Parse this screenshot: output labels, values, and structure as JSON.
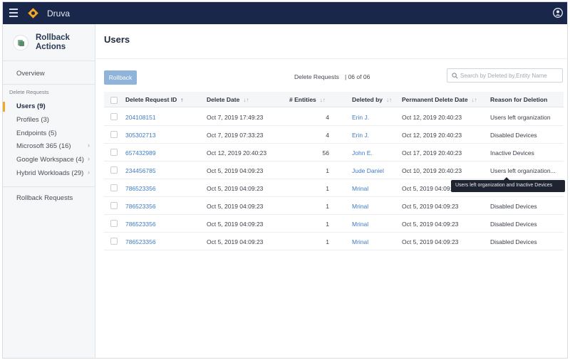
{
  "app": {
    "brand": "Druva"
  },
  "colors": {
    "topbar": "#19284a",
    "accent": "#f5a623",
    "link": "#3f7bc4",
    "button": "#8fb3d9"
  },
  "sidebar": {
    "title": "Rollback Actions",
    "overview": "Overview",
    "section_label": "Delete Requests",
    "items": [
      {
        "label": "Users (9)",
        "active": true
      },
      {
        "label": "Profiles (3)"
      },
      {
        "label": "Endpoints (5)"
      },
      {
        "label": "Microsoft 365 (16)",
        "has_children": true
      },
      {
        "label": "Google Workspace (4)",
        "has_children": true
      },
      {
        "label": "Hybrid Workloads (29)",
        "has_children": true
      }
    ],
    "rollback_requests": "Rollback Requests"
  },
  "main": {
    "title": "Users",
    "rollback_button": "Rollback",
    "count_label": "Delete Requests",
    "count_value": "| 06 of 06",
    "search_placeholder": "Search by Deleted by,Entity Name"
  },
  "table": {
    "columns": [
      "Delete Request ID",
      "Delete Date",
      "# Entities",
      "Deleted by",
      "Permanent Delete Date",
      "Reason for Deletion"
    ],
    "rows": [
      {
        "id": "204108151",
        "delete_date": "Oct 7, 2019 17:49:23",
        "entities": "4",
        "deleted_by": "Erin J.",
        "permanent_date": "Oct 12, 2019 20:40:23",
        "reason": "Users left organization"
      },
      {
        "id": "305302713",
        "delete_date": "Oct 7, 2019 07:33:23",
        "entities": "4",
        "deleted_by": "Erin J.",
        "permanent_date": "Oct 12, 2019 20:40:23",
        "reason": "Disabled Devices"
      },
      {
        "id": "657432989",
        "delete_date": "Oct 12, 2019 20:40:23",
        "entities": "56",
        "deleted_by": "John E.",
        "permanent_date": "Oct 17, 2019 20:40:23",
        "reason": "Inactive Devices"
      },
      {
        "id": "234456785",
        "delete_date": "Oct 5, 2019 04:09:23",
        "entities": "1",
        "deleted_by": "Jude Daniel",
        "permanent_date": "Oct 10, 2019 20:40:23",
        "reason": "Users left organization..."
      },
      {
        "id": "786523356",
        "delete_date": "Oct 5, 2019 04:09:23",
        "entities": "1",
        "deleted_by": "Mrinal",
        "permanent_date": "Oct 5, 2019 04:09:23",
        "reason": ""
      },
      {
        "id": "786523356",
        "delete_date": "Oct 5, 2019 04:09:23",
        "entities": "1",
        "deleted_by": "Mrinal",
        "permanent_date": "Oct 5, 2019 04:09:23",
        "reason": "Disabled Devices"
      },
      {
        "id": "786523356",
        "delete_date": "Oct 5, 2019 04:09:23",
        "entities": "1",
        "deleted_by": "Mrinal",
        "permanent_date": "Oct 5, 2019 04:09:23",
        "reason": "Disabled Devices"
      },
      {
        "id": "786523356",
        "delete_date": "Oct 5, 2019 04:09:23",
        "entities": "1",
        "deleted_by": "Mrinal",
        "permanent_date": "Oct 5, 2019 04:09:23",
        "reason": "Disabled Devices"
      }
    ]
  },
  "tooltip": {
    "text": "Users left organization and Inactive Devices"
  }
}
